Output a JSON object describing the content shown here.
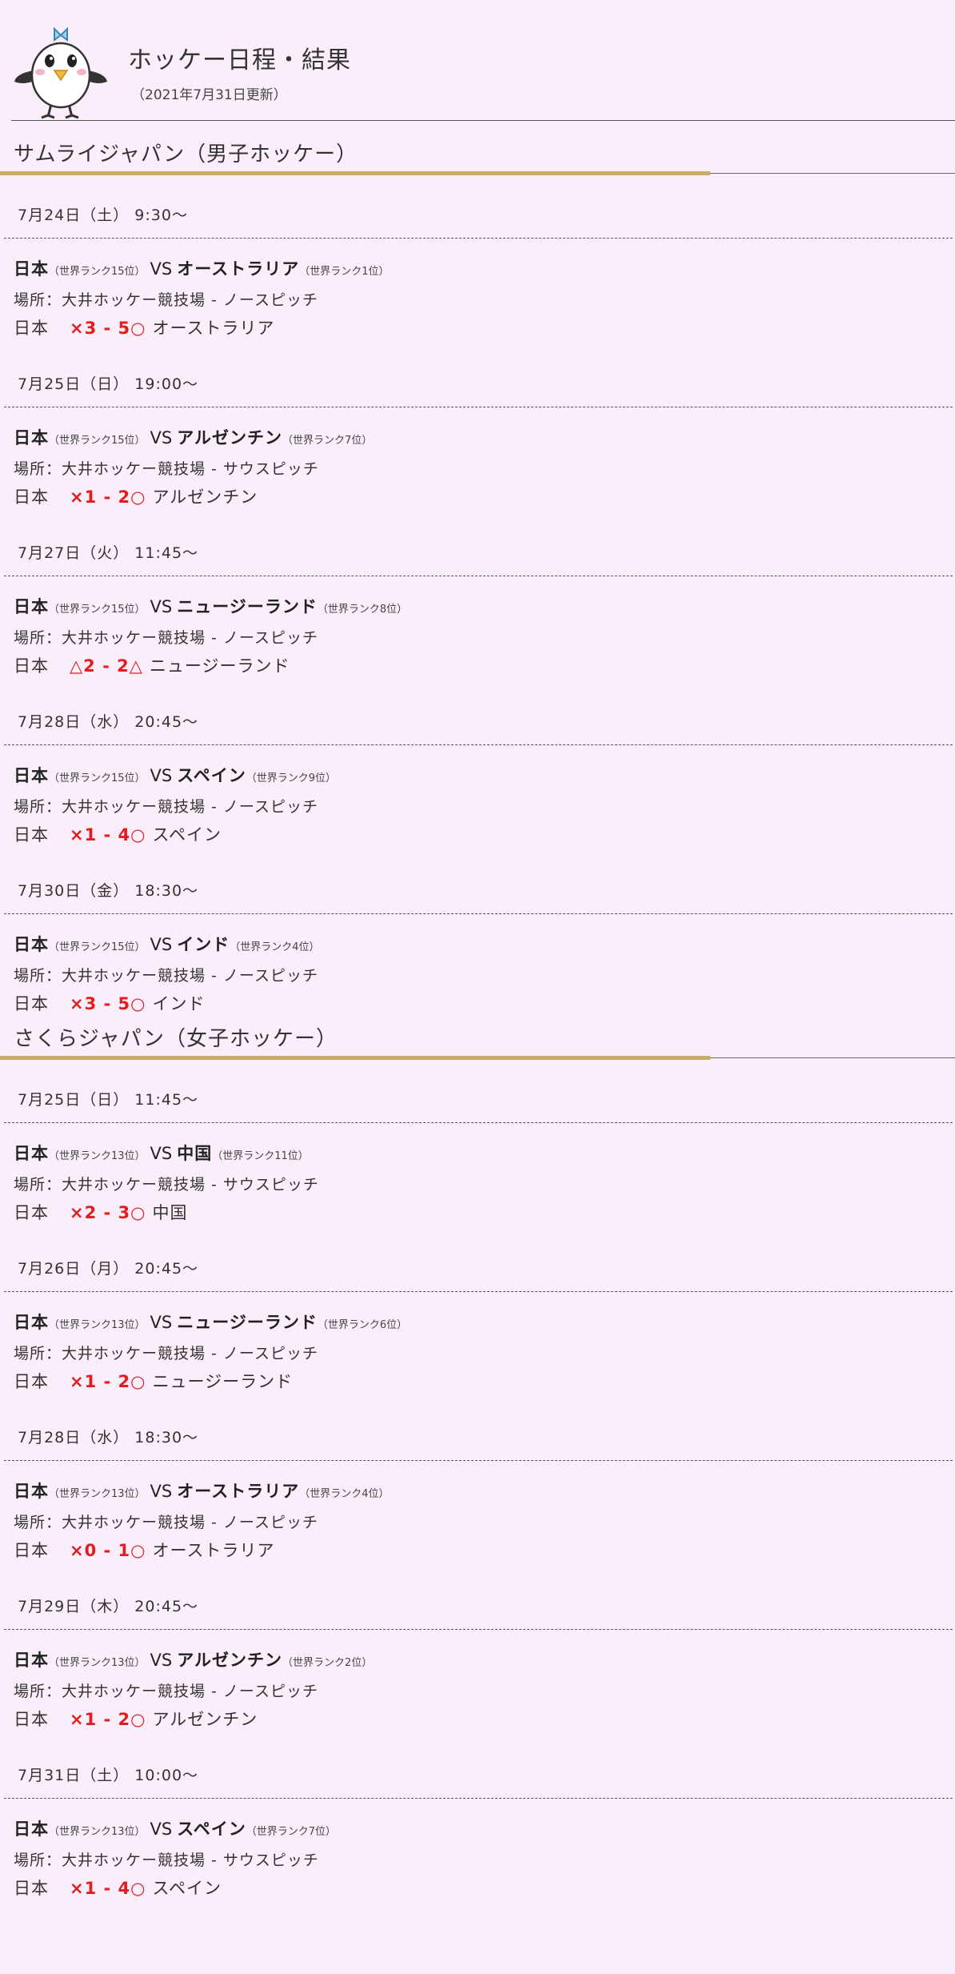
{
  "header": {
    "title": "ホッケー日程・結果",
    "updated": "（2021年7月31日更新）"
  },
  "colors": {
    "background": "#fbeefb",
    "accent_gold": "#c9ad62",
    "score_red": "#e11d1d"
  },
  "sections": [
    {
      "title": "サムライジャパン（男子ホッケー）",
      "matches": [
        {
          "date": "7月24日（土） 9:30～",
          "home": "日本",
          "home_rank": "（世界ランク15位）",
          "vs": "VS",
          "away": "オーストラリア",
          "away_rank": "（世界ランク1位）",
          "venue": "場所：大井ホッケー競技場 - ノースピッチ",
          "result_home": "日本",
          "score": "×3 - 5○",
          "result_away": "オーストラリア"
        },
        {
          "date": "7月25日（日） 19:00～",
          "home": "日本",
          "home_rank": "（世界ランク15位）",
          "vs": "VS",
          "away": "アルゼンチン",
          "away_rank": "（世界ランク7位）",
          "venue": "場所：大井ホッケー競技場 - サウスピッチ",
          "result_home": "日本",
          "score": "×1 - 2○",
          "result_away": "アルゼンチン"
        },
        {
          "date": "7月27日（火） 11:45～",
          "home": "日本",
          "home_rank": "（世界ランク15位）",
          "vs": "VS",
          "away": "ニュージーランド",
          "away_rank": "（世界ランク8位）",
          "venue": "場所：大井ホッケー競技場 - ノースピッチ",
          "result_home": "日本",
          "score": "△2 - 2△",
          "result_away": "ニュージーランド"
        },
        {
          "date": "7月28日（水） 20:45～",
          "home": "日本",
          "home_rank": "（世界ランク15位）",
          "vs": "VS",
          "away": "スペイン",
          "away_rank": "（世界ランク9位）",
          "venue": "場所：大井ホッケー競技場 - ノースピッチ",
          "result_home": "日本",
          "score": "×1 - 4○",
          "result_away": "スペイン"
        },
        {
          "date": "7月30日（金） 18:30～",
          "home": "日本",
          "home_rank": "（世界ランク15位）",
          "vs": "VS",
          "away": "インド",
          "away_rank": "（世界ランク4位）",
          "venue": "場所：大井ホッケー競技場 - ノースピッチ",
          "result_home": "日本",
          "score": "×3 - 5○",
          "result_away": "インド"
        }
      ]
    },
    {
      "title": "さくらジャパン（女子ホッケー）",
      "matches": [
        {
          "date": "7月25日（日） 11:45～",
          "home": "日本",
          "home_rank": "（世界ランク13位）",
          "vs": "VS",
          "away": "中国",
          "away_rank": "（世界ランク11位）",
          "venue": "場所：大井ホッケー競技場 - サウスピッチ",
          "result_home": "日本",
          "score": "×2 - 3○",
          "result_away": "中国"
        },
        {
          "date": "7月26日（月） 20:45～",
          "home": "日本",
          "home_rank": "（世界ランク13位）",
          "vs": "VS",
          "away": "ニュージーランド",
          "away_rank": "（世界ランク6位）",
          "venue": "場所：大井ホッケー競技場 - ノースピッチ",
          "result_home": "日本",
          "score": "×1 - 2○",
          "result_away": "ニュージーランド"
        },
        {
          "date": "7月28日（水） 18:30～",
          "home": "日本",
          "home_rank": "（世界ランク13位）",
          "vs": "VS",
          "away": "オーストラリア",
          "away_rank": "（世界ランク4位）",
          "venue": "場所：大井ホッケー競技場 - ノースピッチ",
          "result_home": "日本",
          "score": "×0 - 1○",
          "result_away": "オーストラリア"
        },
        {
          "date": "7月29日（木） 20:45～",
          "home": "日本",
          "home_rank": "（世界ランク13位）",
          "vs": "VS",
          "away": "アルゼンチン",
          "away_rank": "（世界ランク2位）",
          "venue": "場所：大井ホッケー競技場 - ノースピッチ",
          "result_home": "日本",
          "score": "×1 - 2○",
          "result_away": "アルゼンチン"
        },
        {
          "date": "7月31日（土） 10:00～",
          "home": "日本",
          "home_rank": "（世界ランク13位）",
          "vs": "VS",
          "away": "スペイン",
          "away_rank": "（世界ランク7位）",
          "venue": "場所：大井ホッケー競技場 - サウスピッチ",
          "result_home": "日本",
          "score": "×1 - 4○",
          "result_away": "スペイン"
        }
      ]
    }
  ]
}
